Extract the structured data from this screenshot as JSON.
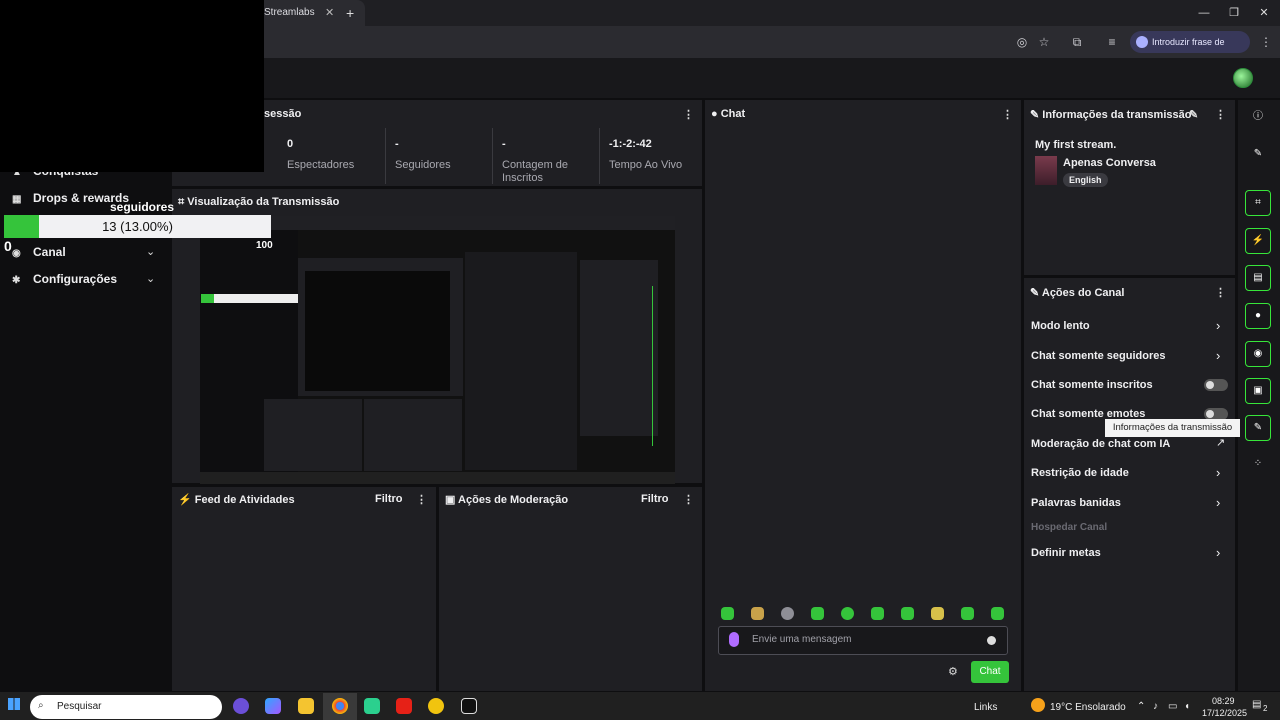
{
  "browser": {
    "tab_title": "Streamlabs",
    "tab_close": "✕",
    "new_tab": "+",
    "passkey_label": "Introduzir frase de acesso",
    "window_controls": [
      "—",
      "❐",
      "✕"
    ]
  },
  "sidebar": {
    "items": [
      {
        "label": "Conquistas",
        "icon": "trophy-icon"
      },
      {
        "label": "Drops & rewards",
        "icon": "gift-icon"
      },
      {
        "label": "Canal",
        "icon": "users-icon"
      },
      {
        "label": "Configurações",
        "icon": "gear-icon"
      }
    ]
  },
  "progress": {
    "label": "seguidores",
    "text": "13 (13.00%)",
    "fraction": 0.13,
    "min": "0",
    "max": "100",
    "color": "#35c43b"
  },
  "session": {
    "title": "sessão",
    "stats": [
      {
        "value": "0",
        "label": "Espectadores"
      },
      {
        "value": "-",
        "label": "Seguidores"
      },
      {
        "value": "-",
        "label": "Contagem de Inscritos"
      },
      {
        "value": "-1:-2:-42",
        "label": "Tempo Ao Vivo"
      }
    ]
  },
  "preview": {
    "title": "Visualização da Transmissão"
  },
  "activity_feed": {
    "title": "Feed de Atividades",
    "filter": "Filtro"
  },
  "moderation": {
    "title": "Ações de Moderação",
    "filter": "Filtro"
  },
  "chat": {
    "title": "Chat",
    "placeholder": "Envie uma mensagem",
    "send_label": "Chat"
  },
  "stream_info": {
    "title": "Informações da transmissão",
    "stream_title": "My first stream.",
    "category": "Apenas Conversa",
    "language_tag": "English"
  },
  "channel_actions": {
    "title": "Ações do Canal",
    "items": [
      {
        "label": "Modo lento",
        "control": "chevron"
      },
      {
        "label": "Chat somente seguidores",
        "control": "chevron"
      },
      {
        "label": "Chat somente inscritos",
        "control": "toggle"
      },
      {
        "label": "Chat somente emotes",
        "control": "toggle"
      },
      {
        "label": "Moderação de chat com IA",
        "control": "external"
      },
      {
        "label": "Restrição de idade",
        "control": "chevron"
      },
      {
        "label": "Palavras banidas",
        "control": "chevron"
      },
      {
        "label": "Hospedar Canal",
        "control": "none"
      },
      {
        "label": "Definir metas",
        "control": "chevron"
      }
    ]
  },
  "tooltip": "Informações da transmissão",
  "taskbar": {
    "search_placeholder": "Pesquisar",
    "links_label": "Links",
    "weather": "19°C  Ensolarado",
    "time": "08:29",
    "date": "17/12/2025",
    "notification_count": "2"
  },
  "colors": {
    "accent": "#35c43b",
    "panel": "#1f1f23",
    "background": "#0e0e10"
  }
}
